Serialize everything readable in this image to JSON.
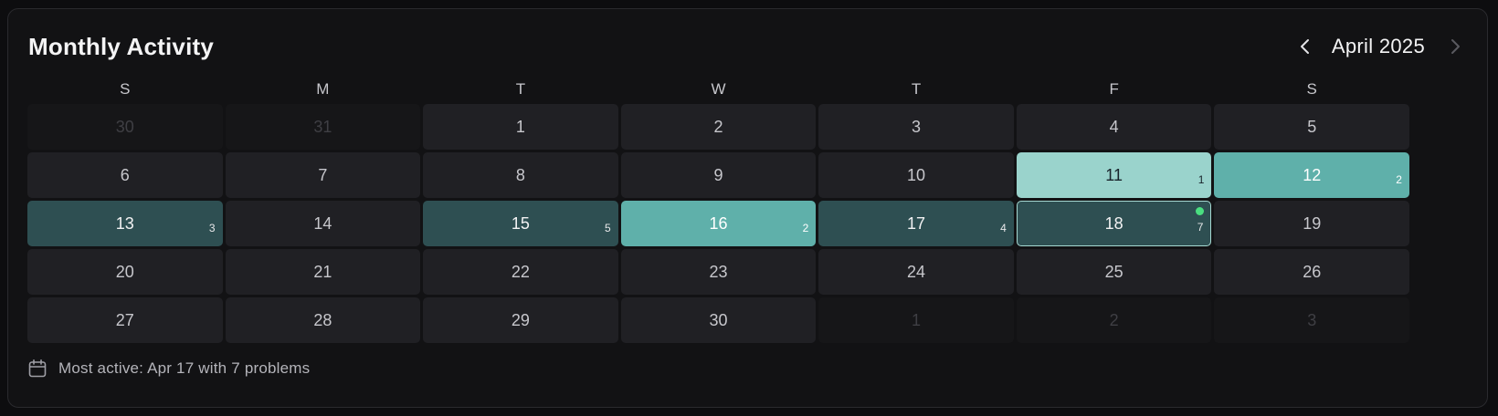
{
  "header": {
    "title": "Monthly Activity",
    "month_label": "April 2025",
    "prev_icon": "chevron-left-icon",
    "next_icon": "chevron-right-icon"
  },
  "weekdays": [
    "S",
    "M",
    "T",
    "W",
    "T",
    "F",
    "S"
  ],
  "days": [
    {
      "day": "30",
      "outside": true,
      "count": null,
      "level": 0
    },
    {
      "day": "31",
      "outside": true,
      "count": null,
      "level": 0
    },
    {
      "day": "1",
      "outside": false,
      "count": null,
      "level": 0
    },
    {
      "day": "2",
      "outside": false,
      "count": null,
      "level": 0
    },
    {
      "day": "3",
      "outside": false,
      "count": null,
      "level": 0
    },
    {
      "day": "4",
      "outside": false,
      "count": null,
      "level": 0
    },
    {
      "day": "5",
      "outside": false,
      "count": null,
      "level": 0
    },
    {
      "day": "6",
      "outside": false,
      "count": null,
      "level": 0
    },
    {
      "day": "7",
      "outside": false,
      "count": null,
      "level": 0
    },
    {
      "day": "8",
      "outside": false,
      "count": null,
      "level": 0
    },
    {
      "day": "9",
      "outside": false,
      "count": null,
      "level": 0
    },
    {
      "day": "10",
      "outside": false,
      "count": null,
      "level": 0
    },
    {
      "day": "11",
      "outside": false,
      "count": "1",
      "level": 3
    },
    {
      "day": "12",
      "outside": false,
      "count": "2",
      "level": 2
    },
    {
      "day": "13",
      "outside": false,
      "count": "3",
      "level": 1
    },
    {
      "day": "14",
      "outside": false,
      "count": null,
      "level": 0
    },
    {
      "day": "15",
      "outside": false,
      "count": "5",
      "level": 1
    },
    {
      "day": "16",
      "outside": false,
      "count": "2",
      "level": 2
    },
    {
      "day": "17",
      "outside": false,
      "count": "4",
      "level": 1
    },
    {
      "day": "18",
      "outside": false,
      "count": "7",
      "level": 1,
      "today": true
    },
    {
      "day": "19",
      "outside": false,
      "count": null,
      "level": 0
    },
    {
      "day": "20",
      "outside": false,
      "count": null,
      "level": 0
    },
    {
      "day": "21",
      "outside": false,
      "count": null,
      "level": 0
    },
    {
      "day": "22",
      "outside": false,
      "count": null,
      "level": 0
    },
    {
      "day": "23",
      "outside": false,
      "count": null,
      "level": 0
    },
    {
      "day": "24",
      "outside": false,
      "count": null,
      "level": 0
    },
    {
      "day": "25",
      "outside": false,
      "count": null,
      "level": 0
    },
    {
      "day": "26",
      "outside": false,
      "count": null,
      "level": 0
    },
    {
      "day": "27",
      "outside": false,
      "count": null,
      "level": 0
    },
    {
      "day": "28",
      "outside": false,
      "count": null,
      "level": 0
    },
    {
      "day": "29",
      "outside": false,
      "count": null,
      "level": 0
    },
    {
      "day": "30",
      "outside": false,
      "count": null,
      "level": 0
    },
    {
      "day": "1",
      "outside": true,
      "count": null,
      "level": 0
    },
    {
      "day": "2",
      "outside": true,
      "count": null,
      "level": 0
    },
    {
      "day": "3",
      "outside": true,
      "count": null,
      "level": 0
    }
  ],
  "footer": {
    "icon": "calendar-icon",
    "text": "Most active: Apr 17 with 7 problems"
  },
  "colors": {
    "level1": "#2e4f52",
    "level2": "#5fb0aa",
    "level3": "#9ad3cc",
    "today_dot": "#4ade80"
  }
}
